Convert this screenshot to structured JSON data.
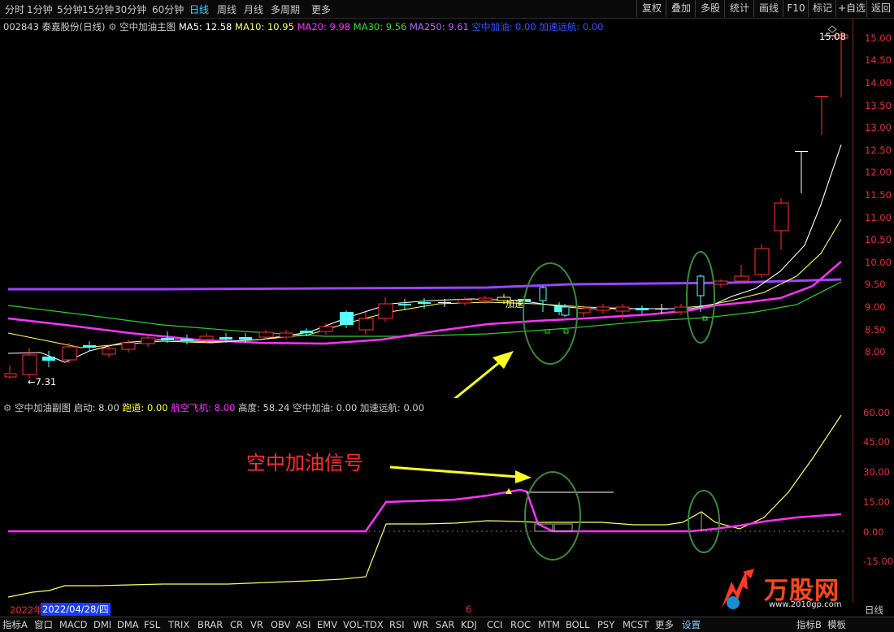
{
  "periods": [
    "分时",
    "1分钟",
    "5分钟",
    "15分钟",
    "30分钟",
    "60分钟",
    "日线",
    "周线",
    "月线",
    "多周期",
    "更多"
  ],
  "active_period": "日线",
  "right_buttons": [
    "复权",
    "叠加",
    "多股",
    "统计",
    "画线",
    "F10",
    "标记",
    "+自选",
    "返回"
  ],
  "main_info": {
    "code": "002843 泰嘉股份(日线)",
    "indicator": "空中加油主图",
    "ma5": "MA5: 12.58",
    "ma10": "MA10: 10.95",
    "ma20": "MA20: 9.98",
    "ma30": "MA30: 9.56",
    "ma250": "MA250: 9.61",
    "sig1": "空中加油: 0.00",
    "sig2": "加速远航: 0.00"
  },
  "sub_info": {
    "name": "空中加油副图",
    "qidong": "启动: 8.00",
    "paodao": "跑道: 0.00",
    "hangkong": "航空飞机: 8.00",
    "gaodu": "高度: 58.24",
    "kzjy": "空中加油: 0.00",
    "jsyh": "加速远航: 0.00"
  },
  "price_ticks": [
    "15.00",
    "14.50",
    "14.00",
    "13.50",
    "13.00",
    "12.50",
    "12.00",
    "11.50",
    "11.00",
    "10.50",
    "10.00",
    "9.50",
    "9.00",
    "8.50",
    "8.00"
  ],
  "sub_ticks": [
    "60.00",
    "45.00",
    "30.00",
    "15.00",
    "0.00",
    "-15.00"
  ],
  "annotations": {
    "high": "15.08",
    "low": "←7.31",
    "signal_label": "空中加油信号",
    "chart_label": "加速"
  },
  "date": {
    "year": "2022年",
    "date": "2022/04/28/四",
    "month_mark": "6"
  },
  "right_label": "日线",
  "bottom_tabs": [
    "指标A",
    "窗口",
    "MACD",
    "DMI",
    "DMA",
    "FSL",
    "TRIX",
    "BRAR",
    "CR",
    "VR",
    "OBV",
    "ASI",
    "EMV",
    "VOL-TDX",
    "RSI",
    "WR",
    "SAR",
    "KDJ",
    "CCI",
    "ROC",
    "MTM",
    "BOLL",
    "PSY",
    "MCST",
    "更多",
    "设置"
  ],
  "bottom_right": [
    "指标B",
    "模板"
  ],
  "watermark": {
    "name": "万股网",
    "url": "www.2010gp.com"
  },
  "colors": {
    "up": "#ff3232",
    "down": "#54ffff",
    "ma5": "#ffffff",
    "ma10": "#ffff66",
    "ma20": "#ff33ff",
    "ma30": "#33dd33",
    "ma250": "#9b45ff",
    "ellipse": "#3a8a3a",
    "arrow": "#ffff22",
    "signal_text": "#ff3030"
  }
}
